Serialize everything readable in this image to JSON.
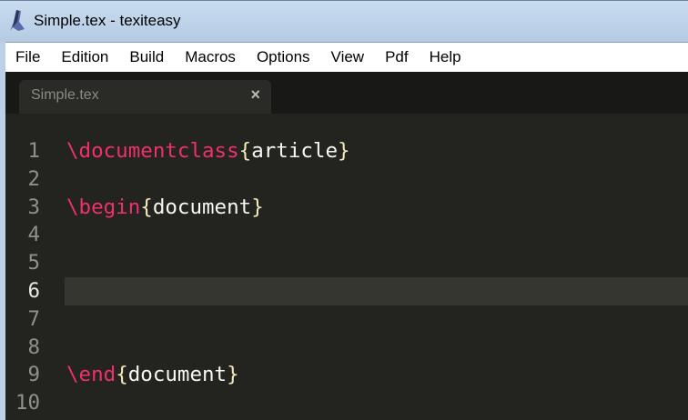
{
  "window": {
    "title": "Simple.tex - texiteasy",
    "icon": "texiteasy-logo-icon"
  },
  "menu": [
    "File",
    "Edition",
    "Build",
    "Macros",
    "Options",
    "View",
    "Pdf",
    "Help"
  ],
  "tab": {
    "label": "Simple.tex",
    "close": "×"
  },
  "editor": {
    "current_line": 6,
    "lines": [
      {
        "n": "1",
        "cmd": "\\documentclass",
        "open": "{",
        "arg": "article",
        "close": "}"
      },
      {
        "n": "2"
      },
      {
        "n": "3",
        "cmd": "\\begin",
        "open": "{",
        "arg": "document",
        "close": "}"
      },
      {
        "n": "4"
      },
      {
        "n": "5"
      },
      {
        "n": "6"
      },
      {
        "n": "7"
      },
      {
        "n": "8"
      },
      {
        "n": "9",
        "cmd": "\\end",
        "open": "{",
        "arg": "document",
        "close": "}"
      },
      {
        "n": "10"
      }
    ]
  },
  "colors": {
    "command": "#f0306e",
    "background": "#23241f",
    "current_line": "#34362f"
  }
}
